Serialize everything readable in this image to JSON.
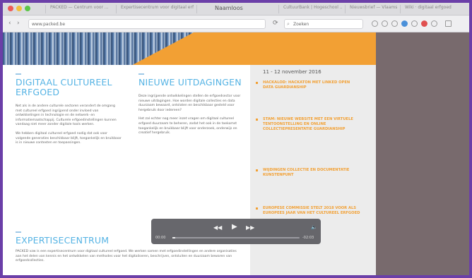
{
  "browser": {
    "window_title": "Naamloos",
    "tabs": [
      "PACKED — Centrum voor ...",
      "Expertisecentrum voor digitaal erfgoed",
      "CultuurBank | Hogeschool ...",
      "Nieuwsbrief — Vlaams ...",
      "Wiki · digitaal erfgoed"
    ],
    "url": "www.packed.be",
    "search_placeholder": "Zoeken",
    "back_glyph": "‹",
    "forward_glyph": "›",
    "reload_glyph": "⟳",
    "search_glyph": "⌕"
  },
  "columns": {
    "col1": {
      "heading": "DIGITAAL CULTUREEL ERFGOED",
      "paragraphs": [
        "Net als in de andere culturele sectoren verandert de omgang met cultureel erfgoed ingrijpend onder invloed van ontwikkelingen in technologie en de netwerk- en informatiemaatschappij. Culturele erfgoedinstellingen kunnen vandaag niet meer zonder digitale tools werken.",
        "We hebben digitaal cultureel erfgoed nodig dat ook voor volgende generaties beschikbaar blijft, toegankelijk en bruikbaar is in nieuwe contexten en toepassingen."
      ]
    },
    "col2": {
      "heading": "NIEUWE UITDAGINGEN",
      "paragraphs": [
        "Deze ingrijpende ontwikkelingen stellen de erfgoedsector voor nieuwe uitdagingen. Hoe worden digitale collecties en data duurzaam bewaard, ontsloten en beschikbaar gesteld voor hergebruik door iedereen?",
        "Het zal echter nog meer inzet vragen om digitaal cultureel erfgoed duurzaam te beheren, zodat het ook in de toekomst toegankelijk en bruikbaar blijft voor onderzoek, onderwijs en creatief hergebruik."
      ]
    },
    "col3": {
      "heading": "EXPERTISECENTRUM",
      "paragraphs": [
        "PACKED vzw is een expertisecentrum voor digitaal cultureel erfgoed. We werken samen met erfgoedinstellingen en andere organisaties aan het delen van kennis en het ontwikkelen van methodes voor het digitaliseren, beschrijven, ontsluiten en duurzaam bewaren van erfgoedcollecties."
      ]
    }
  },
  "sidebar": {
    "date": "11 - 12 november 2016",
    "news": [
      "HACKALOD: HACKATON MET LINKED OPEN DATA GUARDIANSHIP",
      "STAM: NIEUWE WEBSITE MET EEN VIRTUELE TENTOONSTELLING EN ONLINE COLLECTIEPRESENTATIE GUARDIANSHIP",
      "WIJDINGEN COLLECTIE EN DOCUMENTATIE KUNSTENPUNT",
      "EUROPESE COMMISSIE STELT 2018 VOOR ALS EUROPEES JAAR VAN HET CULTUREEL ERFGOED"
    ]
  },
  "player": {
    "elapsed": "00:00",
    "remaining": "-02:03",
    "progress": 0.02,
    "rewind_glyph": "◀◀",
    "play_glyph": "▶",
    "forward_glyph": "▶▶",
    "volume_glyph": "🔈"
  },
  "colors": {
    "accent_orange": "#f2a034",
    "heading_blue": "#55b3e4",
    "frame_purple": "#6b3fa8"
  }
}
